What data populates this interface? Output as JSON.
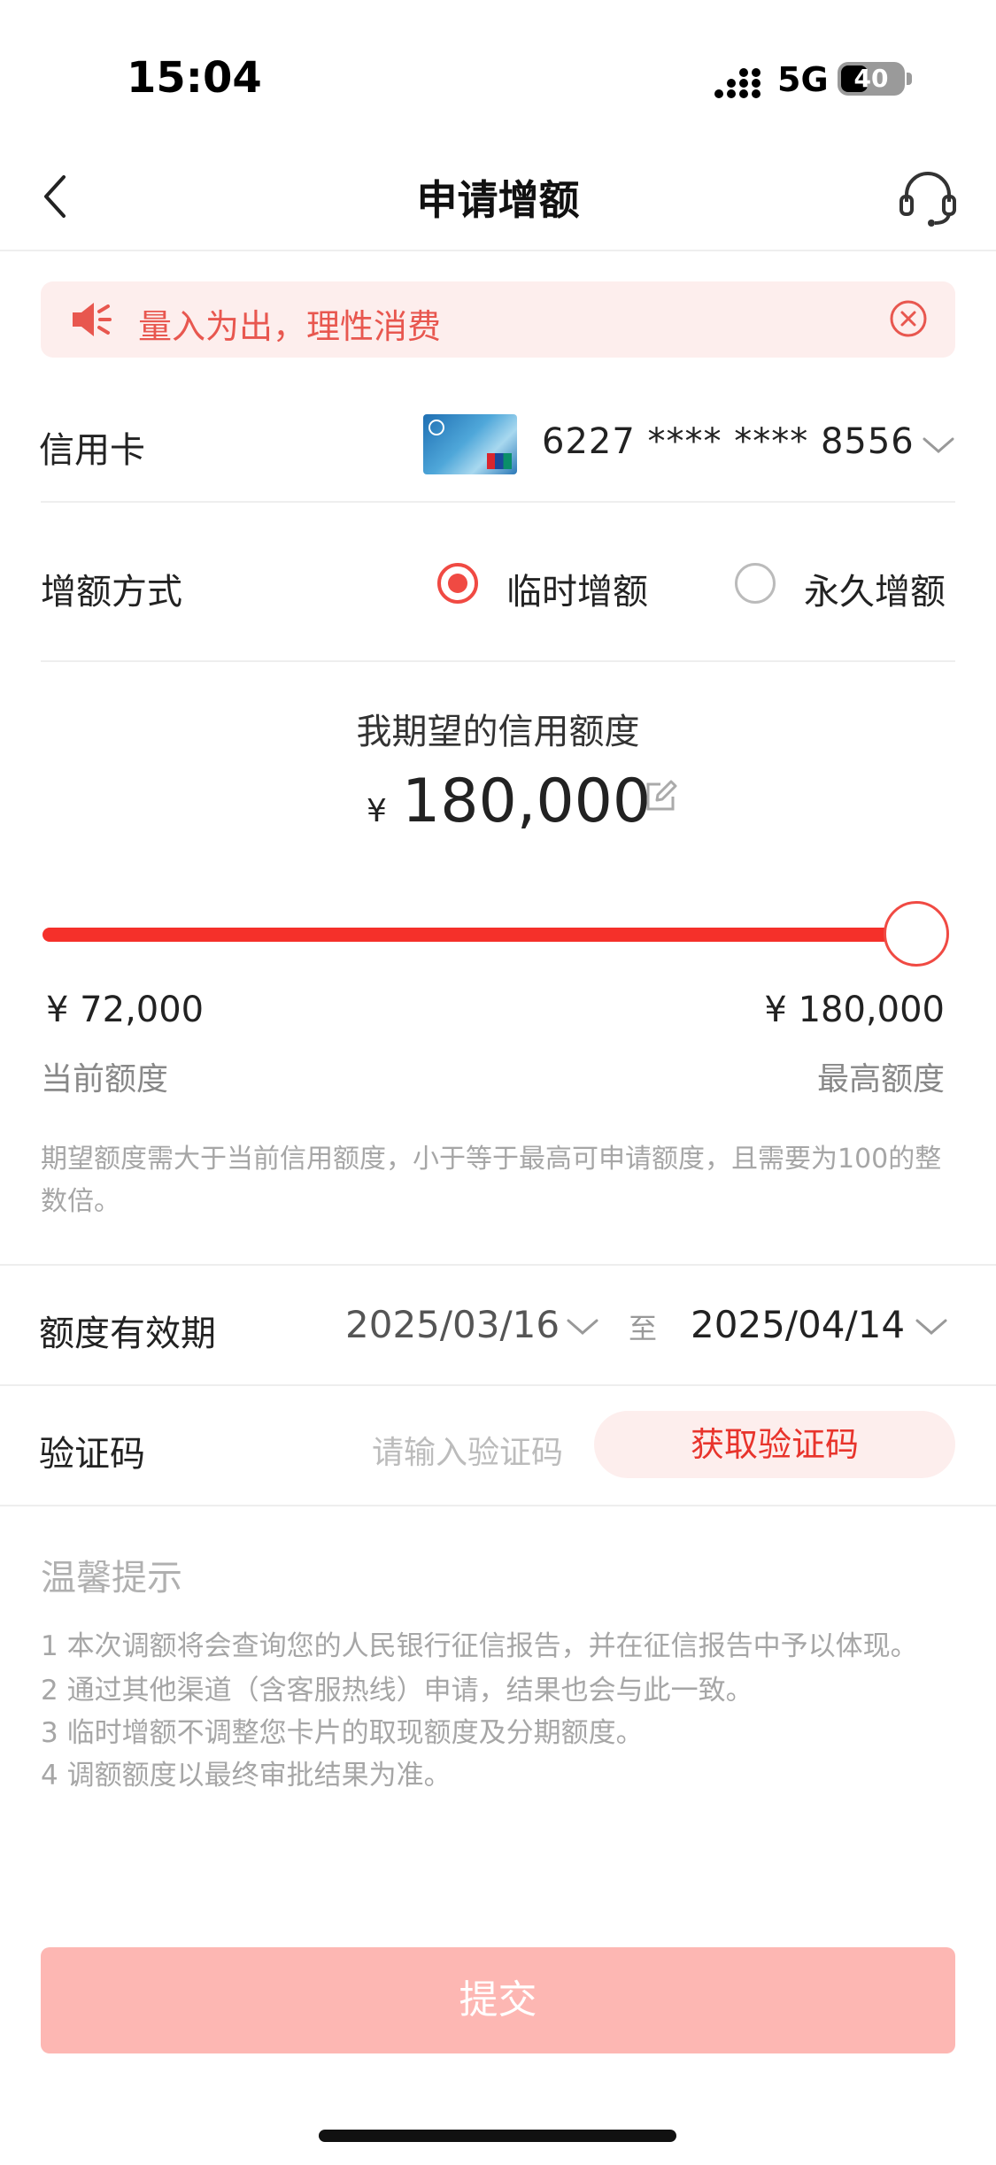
{
  "status_bar": {
    "time": "15:04",
    "network": "5G",
    "battery": "40"
  },
  "nav": {
    "title": "申请增额",
    "back_icon": "chevron-left-icon",
    "service_icon": "headset-icon"
  },
  "notice": {
    "text": "量入为出，理性消费",
    "icon": "speaker-icon",
    "close_icon": "close-circle-icon"
  },
  "card_row": {
    "label": "信用卡",
    "card_number": "6227 **** **** 8556"
  },
  "method_row": {
    "label": "增额方式",
    "options": [
      {
        "label": "临时增额",
        "selected": true
      },
      {
        "label": "永久增额",
        "selected": false
      }
    ]
  },
  "amount": {
    "caption": "我期望的信用额度",
    "currency": "¥",
    "value": "180,000"
  },
  "slider": {
    "level_fraction": 1.0,
    "min_value": "¥ 72,000",
    "min_label": "当前额度",
    "max_value": "¥ 180,000",
    "max_label": "最高额度"
  },
  "hint": "期望额度需大于当前信用额度，小于等于最高可申请额度，且需要为100的整数倍。",
  "validity": {
    "label": "额度有效期",
    "start": "2025/03/16",
    "separator": "至",
    "end": "2025/04/14"
  },
  "verify": {
    "label": "验证码",
    "placeholder": "请输入验证码",
    "button": "获取验证码"
  },
  "tips": {
    "title": "温馨提示",
    "items": [
      "1  本次调额将会查询您的人民银行征信报告，并在征信报告中予以体现。",
      "2  通过其他渠道（含客服热线）申请，结果也会与此一致。",
      "3  临时增额不调整您卡片的取现额度及分期额度。",
      "4  调额额度以最终审批结果为准。"
    ]
  },
  "submit": {
    "label": "提交"
  },
  "colors": {
    "accent": "#f04a43",
    "notice_bg": "#fdeeed",
    "submit_disabled": "#fdb7b3"
  }
}
